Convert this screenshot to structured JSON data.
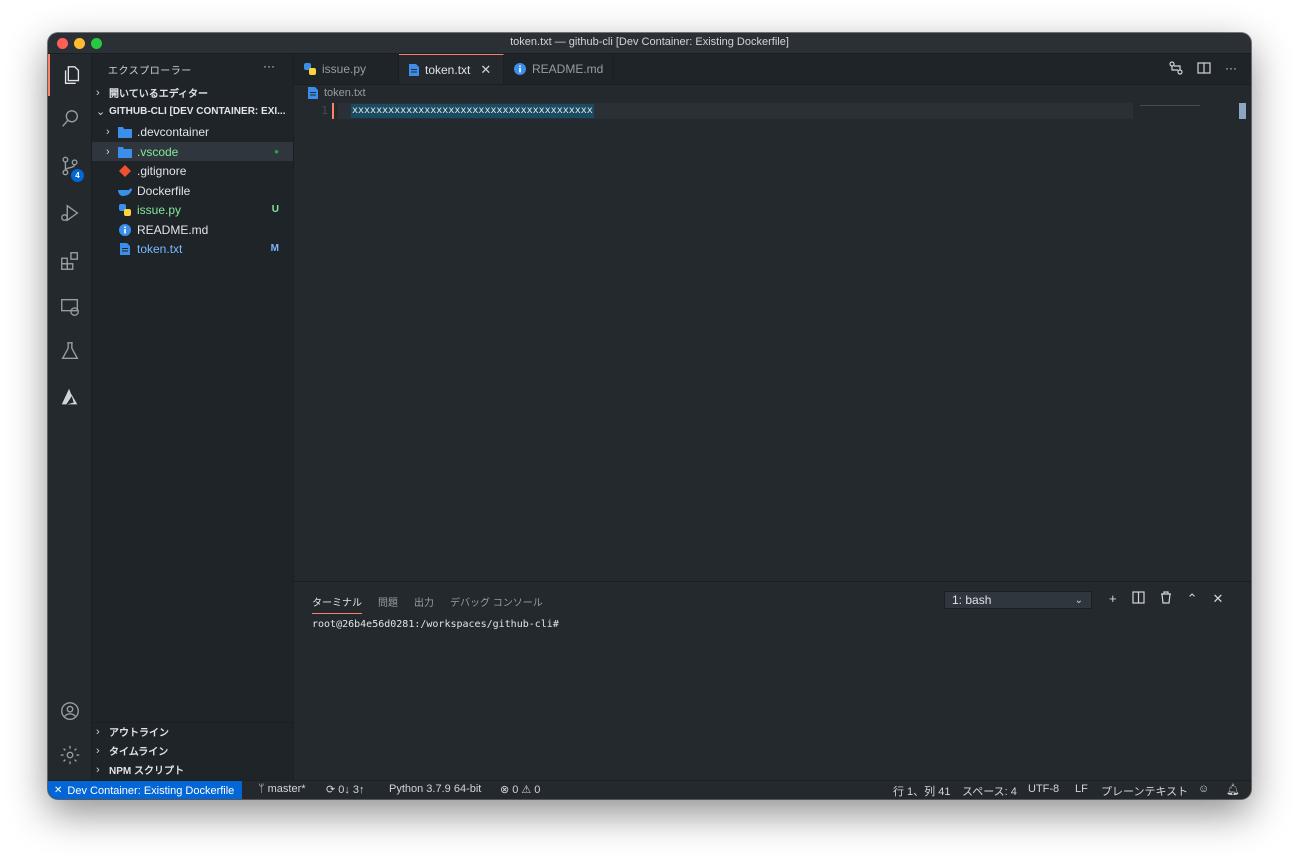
{
  "window": {
    "title": "token.txt — github-cli [Dev Container: Existing Dockerfile]"
  },
  "activity": {
    "scm_badge": "4"
  },
  "sidebar": {
    "header": "エクスプローラー",
    "more": "···",
    "open_editors": "開いているエディター",
    "workspace": "GITHUB-CLI [DEV CONTAINER: EXI...",
    "files": [
      {
        "name": ".devcontainer",
        "deco": ""
      },
      {
        "name": ".vscode",
        "deco": "●"
      },
      {
        "name": ".gitignore",
        "deco": ""
      },
      {
        "name": "Dockerfile",
        "deco": ""
      },
      {
        "name": "issue.py",
        "deco": "U"
      },
      {
        "name": "README.md",
        "deco": ""
      },
      {
        "name": "token.txt",
        "deco": "M"
      }
    ],
    "outline": "アウトライン",
    "timeline": "タイムライン",
    "npm": "NPM スクリプト"
  },
  "tabs": [
    {
      "label": "issue.py"
    },
    {
      "label": "token.txt",
      "close": "✕"
    },
    {
      "label": "README.md"
    }
  ],
  "tab_actions": {
    "more": "···"
  },
  "editor": {
    "breadcrumb": "token.txt",
    "line_number": "1",
    "content": "xxxxxxxxxxxxxxxxxxxxxxxxxxxxxxxxxxxxxxxx"
  },
  "panel": {
    "tabs": [
      "ターミナル",
      "問題",
      "出力",
      "デバッグ コンソール"
    ],
    "terminal_select": "1: bash",
    "terminal_line": "root@26b4e56d0281:/workspaces/github-cli#"
  },
  "status": {
    "remote": "Dev Container: Existing Dockerfile",
    "branch": "master*",
    "sync": "0↓ 3↑",
    "python": "Python 3.7.9 64-bit",
    "errors": "0",
    "warnings": "0",
    "position": "行 1、列 41",
    "spaces": "スペース: 4",
    "encoding": "UTF-8",
    "eol": "LF",
    "language": "プレーンテキスト"
  },
  "colors": {
    "accent": "#f9826c",
    "remote_bg": "#0366d6",
    "bg": "#24292e",
    "sidebar_bg": "#1f2428"
  }
}
